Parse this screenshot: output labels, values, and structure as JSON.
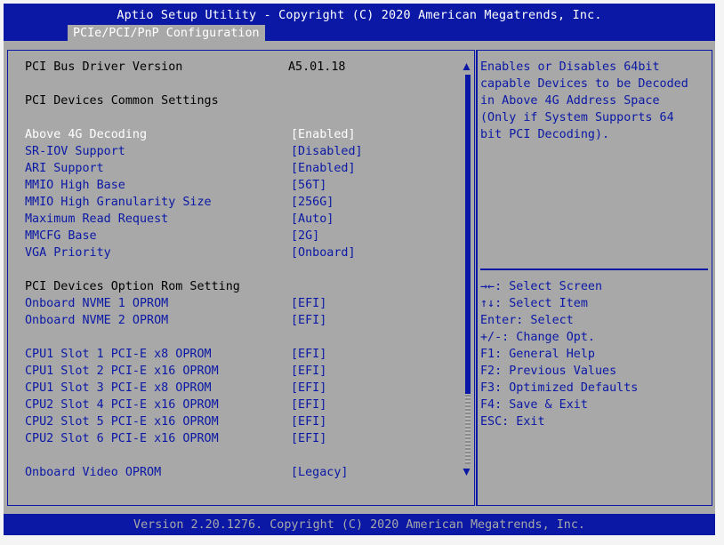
{
  "header": {
    "title": "Aptio Setup Utility - Copyright (C) 2020 American Megatrends, Inc.",
    "tab": "PCIe/PCI/PnP Configuration"
  },
  "info": {
    "driver_label": "PCI Bus Driver Version",
    "driver_value": "A5.01.18",
    "common_heading": "PCI Devices Common Settings",
    "rom_heading": "PCI Devices Option Rom Setting"
  },
  "settings": [
    {
      "label": "Above 4G Decoding",
      "value": "[Enabled]"
    },
    {
      "label": "SR-IOV Support",
      "value": "[Disabled]"
    },
    {
      "label": "ARI Support",
      "value": "[Enabled]"
    },
    {
      "label": "MMIO High Base",
      "value": "[56T]"
    },
    {
      "label": "MMIO High Granularity Size",
      "value": "[256G]"
    },
    {
      "label": "Maximum Read Request",
      "value": "[Auto]"
    },
    {
      "label": "MMCFG Base",
      "value": "[2G]"
    },
    {
      "label": "VGA Priority",
      "value": "[Onboard]"
    }
  ],
  "nvme_settings": [
    {
      "label": "Onboard NVME 1 OPROM",
      "value": "[EFI]"
    },
    {
      "label": "Onboard NVME 2 OPROM",
      "value": "[EFI]"
    }
  ],
  "slot_settings": [
    {
      "label": "CPU1 Slot 1 PCI-E x8 OPROM",
      "value": "[EFI]"
    },
    {
      "label": "CPU1 Slot 2 PCI-E x16 OPROM",
      "value": "[EFI]"
    },
    {
      "label": "CPU1 Slot 3 PCI-E x8 OPROM",
      "value": "[EFI]"
    },
    {
      "label": "CPU2 Slot 4 PCI-E x16 OPROM",
      "value": "[EFI]"
    },
    {
      "label": "CPU2 Slot 5 PCI-E x16 OPROM",
      "value": "[EFI]"
    },
    {
      "label": "CPU2 Slot 6 PCI-E x16 OPROM",
      "value": "[EFI]"
    }
  ],
  "video_setting": {
    "label": "Onboard Video OPROM",
    "value": "[Legacy]"
  },
  "help": {
    "description": [
      "Enables or Disables 64bit",
      "capable Devices to be Decoded",
      "in Above 4G Address Space",
      "(Only if System Supports 64",
      "bit PCI Decoding)."
    ],
    "keys": [
      "→←: Select Screen",
      "↑↓: Select Item",
      "Enter: Select",
      "+/-: Change Opt.",
      "F1: General Help",
      "F2: Previous Values",
      "F3: Optimized Defaults",
      "F4: Save & Exit",
      "ESC: Exit"
    ]
  },
  "footer": {
    "version": "Version 2.20.1276. Copyright (C) 2020 American Megatrends, Inc."
  },
  "colors": {
    "bar_blue": "#0a18a5",
    "background_gray": "#a8a8a8",
    "highlight_white": "#ffffff"
  },
  "scrollbar": {
    "visible_fraction": 0.82
  }
}
